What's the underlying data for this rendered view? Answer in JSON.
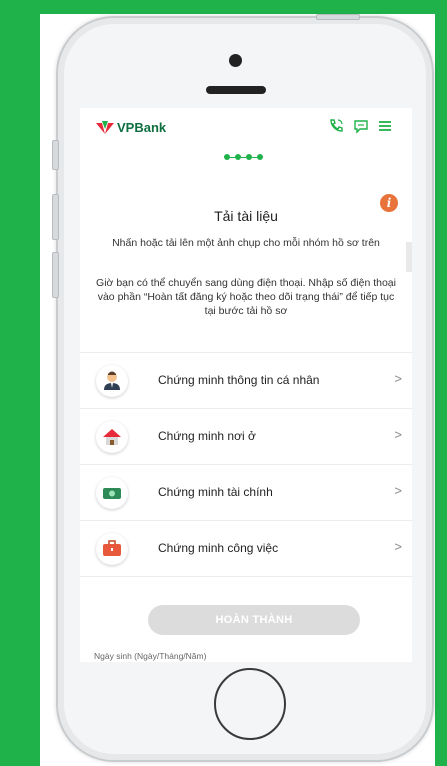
{
  "brand": {
    "name": "VPBank",
    "green": "#1fb24a",
    "orange": "#e8743b"
  },
  "header": {
    "icons": [
      "phone-icon",
      "chat-icon",
      "menu-icon"
    ]
  },
  "progress": {
    "total_steps": 4,
    "current_step": 4
  },
  "page": {
    "title": "Tải tài liệu",
    "instruction": "Nhấn hoặc tải lên một ảnh chụp cho mỗi nhóm hồ sơ trên",
    "note": "Giờ bạn có thể chuyển sang dùng điện thoại. Nhập số điện thoại vào phần “Hoàn tất đăng ký hoặc theo dõi trạng thái” để tiếp tục tại bước tải hồ sơ"
  },
  "documents": [
    {
      "label": "Chứng minh thông tin cá nhân",
      "icon": "person-icon"
    },
    {
      "label": "Chứng minh nơi ở",
      "icon": "house-icon"
    },
    {
      "label": "Chứng minh tài chính",
      "icon": "money-icon"
    },
    {
      "label": "Chứng minh công việc",
      "icon": "briefcase-icon"
    }
  ],
  "chevron": ">",
  "finish_button": "HOÀN THÀNH",
  "dob_label": "Ngày sinh (Ngày/Tháng/Năm)"
}
